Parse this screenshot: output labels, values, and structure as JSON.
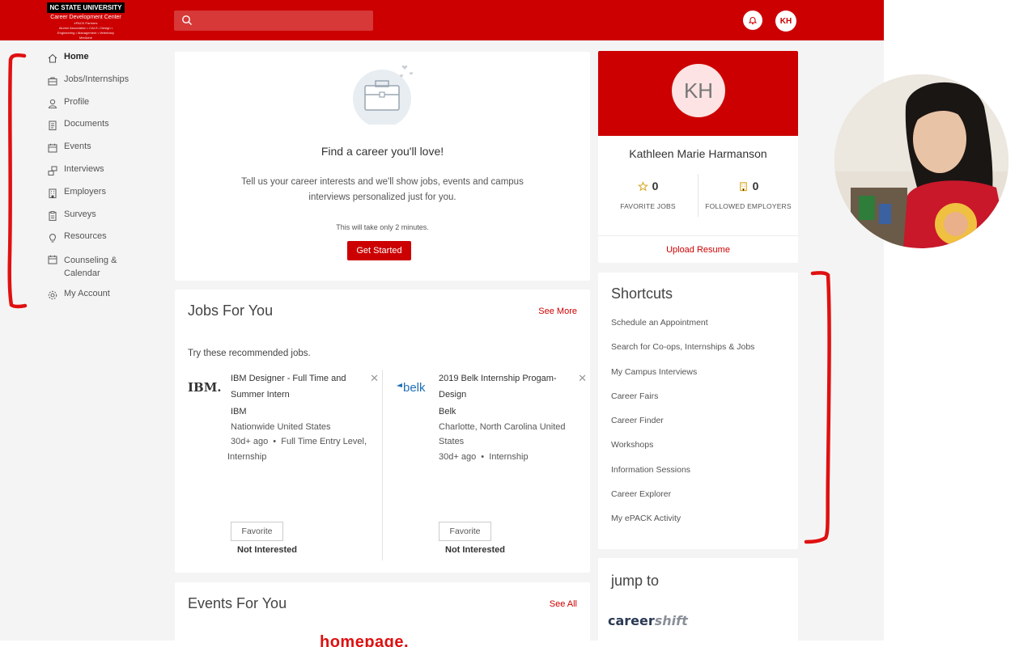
{
  "header": {
    "logo_line1": "NC STATE UNIVERSITY",
    "logo_line2": "Career Development Center",
    "logo_line3": "ePACK Partners",
    "logo_line4": "Alumni Association • CALS • Design •",
    "logo_line5": "Engineering • Management • Veterinary",
    "logo_line6": "Medicine",
    "search_placeholder": "",
    "user_initials": "KH",
    "brand_color": "#cc0000"
  },
  "sidebar": {
    "items": [
      {
        "label": "Home",
        "icon": "home-icon"
      },
      {
        "label": "Jobs/Internships",
        "icon": "briefcase-icon"
      },
      {
        "label": "Profile",
        "icon": "person-icon"
      },
      {
        "label": "Documents",
        "icon": "documents-icon"
      },
      {
        "label": "Events",
        "icon": "calendar-icon"
      },
      {
        "label": "Interviews",
        "icon": "interviews-icon"
      },
      {
        "label": "Employers",
        "icon": "building-icon"
      },
      {
        "label": "Surveys",
        "icon": "clipboard-icon"
      },
      {
        "label": "Resources",
        "icon": "lightbulb-icon"
      },
      {
        "label": "Counseling &",
        "label2": "Calendar",
        "icon": "calendar-icon"
      },
      {
        "label": "My Account",
        "icon": "gear-icon"
      }
    ]
  },
  "hero": {
    "title": "Find a career you'll love!",
    "subtitle": "Tell us your career interests and we'll show jobs, events and campus interviews personalized just for you.",
    "note": "This will take only 2 minutes.",
    "button": "Get Started"
  },
  "jobs": {
    "title": "Jobs For You",
    "see_more": "See More",
    "intro": "Try these recommended jobs.",
    "items": [
      {
        "logo": "IBM.",
        "title": "IBM Designer - Full Time and Summer Intern",
        "company": "IBM",
        "location": "Nationwide United States",
        "posted": "30d+ ago",
        "type": "Full Time Entry Level,",
        "type2": "Internship",
        "favorite": "Favorite",
        "not_interested": "Not Interested",
        "close": "✕"
      },
      {
        "logo": "belk",
        "title": "2019 Belk Internship Progam-Design",
        "company": "Belk",
        "location": "Charlotte, North Carolina United States",
        "posted": "30d+ ago",
        "type": "Internship",
        "favorite": "Favorite",
        "not_interested": "Not Interested",
        "close": "✕"
      }
    ]
  },
  "events": {
    "title": "Events For You",
    "see_all": "See All"
  },
  "profile": {
    "initials": "KH",
    "name": "Kathleen Marie Harmanson",
    "favorite_jobs_count": "0",
    "favorite_jobs_label": "FAVORITE JOBS",
    "followed_employers_count": "0",
    "followed_employers_label": "FOLLOWED EMPLOYERS",
    "upload": "Upload Resume"
  },
  "shortcuts": {
    "title": "Shortcuts",
    "items": [
      "Schedule an Appointment",
      "Search for Co-ops, Internships & Jobs",
      "My Campus Interviews",
      "Career Fairs",
      "Career Finder",
      "Workshops",
      "Information Sessions",
      "Career Explorer",
      "My ePACK Activity"
    ]
  },
  "jump": {
    "title": "jump to",
    "career": "career",
    "shift": "shift"
  },
  "annotation": {
    "text": "homepage."
  }
}
